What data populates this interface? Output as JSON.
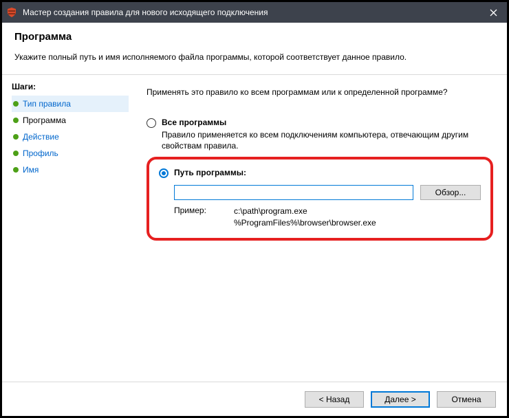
{
  "window": {
    "title": "Мастер создания правила для нового исходящего подключения"
  },
  "header": {
    "title": "Программа",
    "subtitle": "Укажите полный путь и имя исполняемого файла программы, которой соответствует данное правило."
  },
  "sidebar": {
    "heading": "Шаги:",
    "steps": [
      {
        "label": "Тип правила"
      },
      {
        "label": "Программа"
      },
      {
        "label": "Действие"
      },
      {
        "label": "Профиль"
      },
      {
        "label": "Имя"
      }
    ]
  },
  "main": {
    "prompt": "Применять это правило ко всем программам или к определенной программе?",
    "all_programs": {
      "label": "Все программы",
      "desc": "Правило применяется ко всем подключениям компьютера, отвечающим другим свойствам правила."
    },
    "program_path": {
      "label": "Путь программы:",
      "value": "",
      "browse": "Обзор...",
      "example_label": "Пример:",
      "example_values": "c:\\path\\program.exe\n%ProgramFiles%\\browser\\browser.exe"
    }
  },
  "footer": {
    "back": "< Назад",
    "next": "Далее >",
    "cancel": "Отмена"
  }
}
